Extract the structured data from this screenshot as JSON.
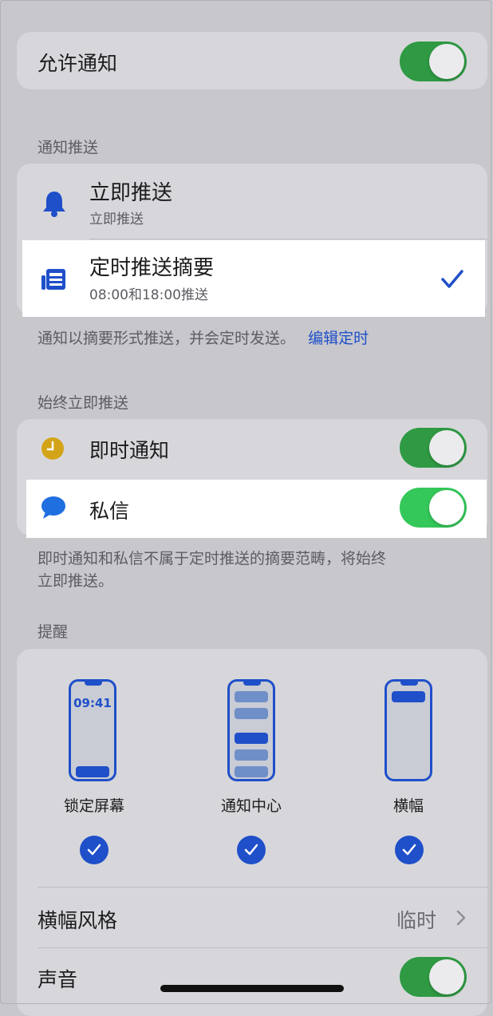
{
  "allow_notifications": {
    "label": "允许通知",
    "enabled": true
  },
  "delivery": {
    "section_title": "通知推送",
    "options": [
      {
        "title": "立即推送",
        "subtitle": "立即推送",
        "icon": "bell-icon",
        "selected": false
      },
      {
        "title": "定时推送摘要",
        "subtitle": "08:00和18:00推送",
        "icon": "summary-icon",
        "selected": true
      }
    ],
    "footer_text": "通知以摘要形式推送，并会定时发送。",
    "footer_link": "编辑定时"
  },
  "always_immediate": {
    "section_title": "始终立即推送",
    "items": [
      {
        "label": "即时通知",
        "icon": "clock-icon",
        "enabled": true
      },
      {
        "label": "私信",
        "icon": "message-icon",
        "enabled": true
      }
    ],
    "footer_line1": "即时通知和私信不属于定时推送的摘要范畴，将始终",
    "footer_line2": "立即推送。"
  },
  "alerts": {
    "section_title": "提醒",
    "lock_time": "09:41",
    "styles": [
      {
        "label": "锁定屏幕",
        "checked": true
      },
      {
        "label": "通知中心",
        "checked": true
      },
      {
        "label": "横幅",
        "checked": true
      }
    ],
    "banner_style": {
      "label": "横幅风格",
      "value": "临时"
    },
    "sound": {
      "label": "声音",
      "enabled": true
    }
  },
  "colors": {
    "accent": "#1f4fc9",
    "toggle_on": "#34c759",
    "background": "#c7c7cc"
  }
}
